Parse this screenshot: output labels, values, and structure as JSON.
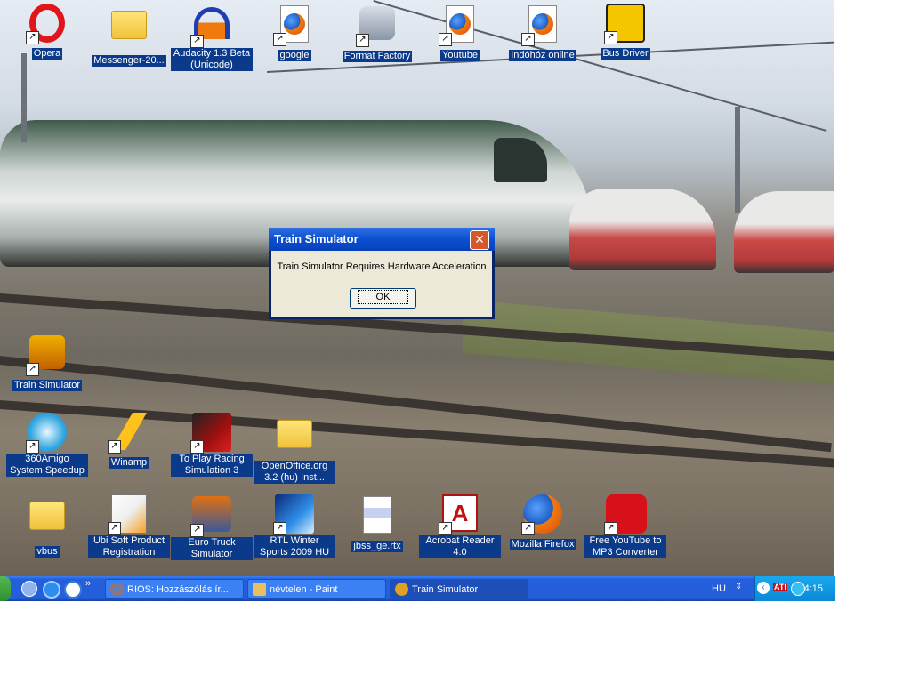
{
  "desktop_icons": [
    {
      "label": "Opera",
      "icon": "opera-icon"
    },
    {
      "label": "Messenger-20...",
      "icon": "folder-icon"
    },
    {
      "label": "Audacity 1.3 Beta (Unicode)",
      "icon": "audacity-icon"
    },
    {
      "label": "google",
      "icon": "firefox-page-icon"
    },
    {
      "label": "Format Factory",
      "icon": "format-factory-icon"
    },
    {
      "label": "Youtube",
      "icon": "firefox-page-icon"
    },
    {
      "label": "Indóhóz online",
      "icon": "firefox-page-icon"
    },
    {
      "label": "Bus Driver",
      "icon": "bus-driver-icon"
    },
    {
      "label": "Train Simulator",
      "icon": "train-simulator-icon"
    },
    {
      "label": "360Amigo System Speedup",
      "icon": "amigo-icon"
    },
    {
      "label": "Winamp",
      "icon": "winamp-icon"
    },
    {
      "label": "To Play Racing Simulation 3",
      "icon": "racing-icon"
    },
    {
      "label": "OpenOffice.org 3.2 (hu) Inst...",
      "icon": "folder-icon"
    },
    {
      "label": "vbus",
      "icon": "folder-icon"
    },
    {
      "label": "Ubi Soft Product Registration",
      "icon": "ubisoft-icon"
    },
    {
      "label": "Euro Truck Simulator",
      "icon": "truck-icon"
    },
    {
      "label": "RTL Winter Sports 2009 HU",
      "icon": "winter-sports-icon"
    },
    {
      "label": "jbss_ge.rtx",
      "icon": "document-icon"
    },
    {
      "label": "Acrobat Reader 4.0",
      "icon": "acrobat-icon"
    },
    {
      "label": "Mozilla Firefox",
      "icon": "firefox-icon"
    },
    {
      "label": "Free YouTube to MP3 Converter",
      "icon": "mp3-icon"
    }
  ],
  "dialog": {
    "title": "Train Simulator",
    "message": "Train Simulator Requires Hardware Acceleration",
    "ok_label": "OK",
    "close_glyph": "✕"
  },
  "taskbar": {
    "chevron": "»",
    "tasks": [
      {
        "label": "RIOS: Hozzászólás ír...",
        "icon": "firefox-icon"
      },
      {
        "label": "névtelen - Paint",
        "icon": "paint-icon"
      },
      {
        "label": "Train Simulator",
        "icon": "train-simulator-icon"
      }
    ],
    "language": "HU",
    "clock": "4:15",
    "tray_badge": "ATI"
  },
  "colors": {
    "taskbar_blue": "#245edb",
    "dialog_title": "#0a4fd2",
    "label_highlight": "#0b3a8a"
  }
}
